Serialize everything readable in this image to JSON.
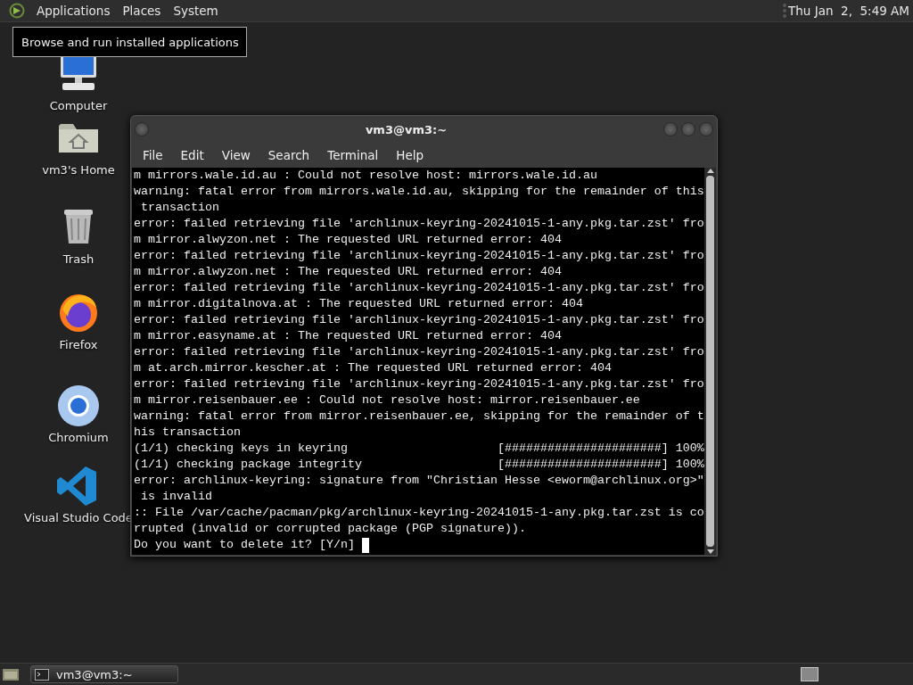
{
  "top_panel": {
    "menus": [
      "Applications",
      "Places",
      "System"
    ],
    "clock": "Thu Jan  2,  5:49 AM"
  },
  "tooltip": "Browse and run installed applications",
  "desktop_icons": [
    {
      "kind": "computer",
      "label": "Computer"
    },
    {
      "kind": "home",
      "label": "vm3's Home"
    },
    {
      "kind": "trash",
      "label": "Trash"
    },
    {
      "kind": "firefox",
      "label": "Firefox"
    },
    {
      "kind": "chromium",
      "label": "Chromium"
    },
    {
      "kind": "vscode",
      "label": "Visual Studio Code"
    }
  ],
  "terminal": {
    "title": "vm3@vm3:~",
    "menu": [
      "File",
      "Edit",
      "View",
      "Search",
      "Terminal",
      "Help"
    ],
    "lines": [
      "m mirrors.wale.id.au : Could not resolve host: mirrors.wale.id.au",
      "warning: fatal error from mirrors.wale.id.au, skipping for the remainder of this",
      " transaction",
      "error: failed retrieving file 'archlinux-keyring-20241015-1-any.pkg.tar.zst' fro",
      "m mirror.alwyzon.net : The requested URL returned error: 404",
      "error: failed retrieving file 'archlinux-keyring-20241015-1-any.pkg.tar.zst' fro",
      "m mirror.alwyzon.net : The requested URL returned error: 404",
      "error: failed retrieving file 'archlinux-keyring-20241015-1-any.pkg.tar.zst' fro",
      "m mirror.digitalnova.at : The requested URL returned error: 404",
      "error: failed retrieving file 'archlinux-keyring-20241015-1-any.pkg.tar.zst' fro",
      "m mirror.easyname.at : The requested URL returned error: 404",
      "error: failed retrieving file 'archlinux-keyring-20241015-1-any.pkg.tar.zst' fro",
      "m at.arch.mirror.kescher.at : The requested URL returned error: 404",
      "error: failed retrieving file 'archlinux-keyring-20241015-1-any.pkg.tar.zst' fro",
      "m mirror.reisenbauer.ee : Could not resolve host: mirror.reisenbauer.ee",
      "warning: fatal error from mirror.reisenbauer.ee, skipping for the remainder of t",
      "his transaction",
      "(1/1) checking keys in keyring                     [######################] 100%",
      "(1/1) checking package integrity                   [######################] 100%",
      "error: archlinux-keyring: signature from \"Christian Hesse <eworm@archlinux.org>\"",
      " is invalid",
      ":: File /var/cache/pacman/pkg/archlinux-keyring-20241015-1-any.pkg.tar.zst is co",
      "rrupted (invalid or corrupted package (PGP signature)).",
      "Do you want to delete it? [Y/n] "
    ]
  },
  "taskbar": {
    "windows": [
      {
        "label": "vm3@vm3:~"
      }
    ]
  }
}
